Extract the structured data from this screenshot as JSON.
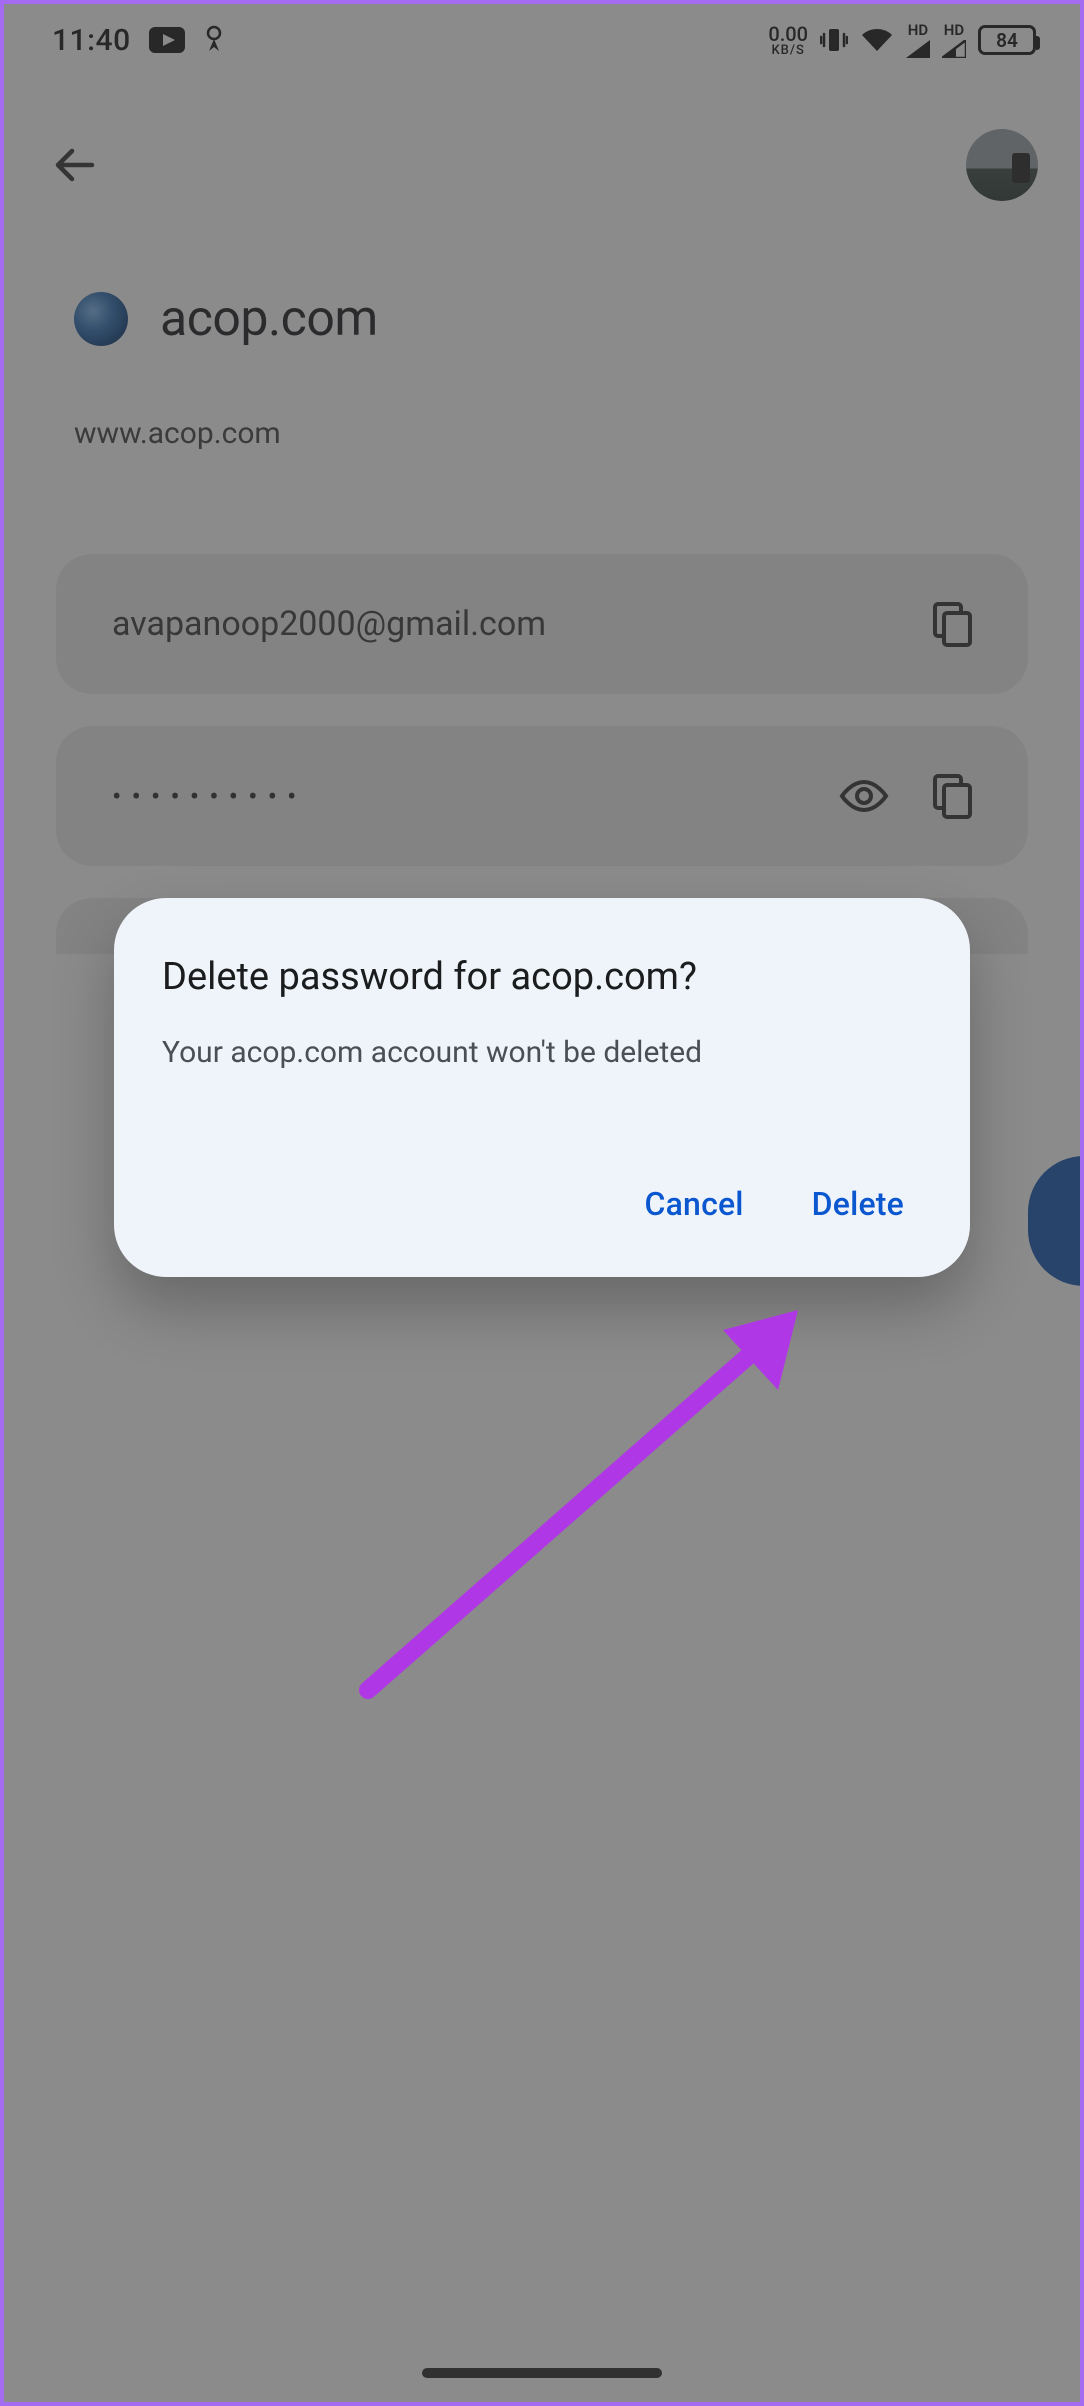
{
  "status_bar": {
    "time": "11:40",
    "data_rate_value": "0.00",
    "data_rate_unit": "KB/S",
    "network_label": "HD",
    "battery_percent": "84"
  },
  "page": {
    "site_title": "acop.com",
    "site_url": "www.acop.com",
    "username": "avapanoop2000@gmail.com",
    "password_masked": "••••••••••"
  },
  "dialog": {
    "title": "Delete password for acop.com?",
    "body": "Your acop.com account won't be deleted",
    "cancel_label": "Cancel",
    "confirm_label": "Delete"
  }
}
